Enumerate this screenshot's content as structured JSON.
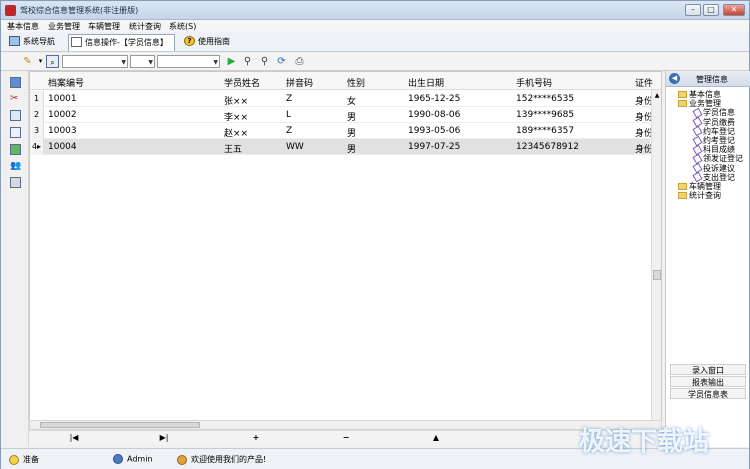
{
  "window": {
    "title": "驾校综合信息管理系统(非注册版)"
  },
  "menu": [
    "基本信息",
    "业务管理",
    "车辆管理",
    "统计查询",
    "系统(S)"
  ],
  "nav_tabs": [
    {
      "label": "系统导航",
      "icon": "monitor-icon"
    },
    {
      "label": "信息操作-【学员信息】",
      "icon": "document-icon"
    },
    {
      "label": "使用指南",
      "icon": "help-icon"
    }
  ],
  "grid": {
    "columns": [
      "档案编号",
      "学员姓名",
      "拼音码",
      "性别",
      "出生日期",
      "手机号码",
      "证件"
    ],
    "rows": [
      {
        "num": "1",
        "id": "10001",
        "name": "张××",
        "pinyin": "Z",
        "gender": "女",
        "birth": "1965-12-25",
        "phone": "152****6535",
        "cert": "身份"
      },
      {
        "num": "2",
        "id": "10002",
        "name": "李××",
        "pinyin": "L",
        "gender": "男",
        "birth": "1990-08-06",
        "phone": "139****9685",
        "cert": "身份"
      },
      {
        "num": "3",
        "id": "10003",
        "name": "赵××",
        "pinyin": "Z",
        "gender": "男",
        "birth": "1993-05-06",
        "phone": "189****6357",
        "cert": "身份"
      },
      {
        "num": "4",
        "id": "10004",
        "name": "王五",
        "pinyin": "WW",
        "gender": "男",
        "birth": "1997-07-25",
        "phone": "12345678912",
        "cert": "身份"
      }
    ]
  },
  "pager": {
    "first": "|◀",
    "last": "▶|",
    "add": "+",
    "remove": "−",
    "up": "▲"
  },
  "right_panel": {
    "title": "管理信息",
    "tree": [
      {
        "label": "基本信息",
        "type": "folder",
        "level": 0
      },
      {
        "label": "业务管理",
        "type": "folder",
        "level": 0
      },
      {
        "label": "学员信息",
        "type": "leaf",
        "level": 1
      },
      {
        "label": "学员缴费",
        "type": "leaf",
        "level": 1
      },
      {
        "label": "约车登记",
        "type": "leaf",
        "level": 1
      },
      {
        "label": "约考登记",
        "type": "leaf",
        "level": 1
      },
      {
        "label": "科目成绩",
        "type": "leaf",
        "level": 1
      },
      {
        "label": "领发证登记",
        "type": "leaf",
        "level": 1
      },
      {
        "label": "投诉建议",
        "type": "leaf",
        "level": 1
      },
      {
        "label": "支出登记",
        "type": "leaf",
        "level": 1
      },
      {
        "label": "车辆管理",
        "type": "folder",
        "level": 0
      },
      {
        "label": "统计查询",
        "type": "folder",
        "level": 0
      }
    ],
    "buttons": [
      "录入窗口",
      "报表输出",
      "学员信息表"
    ]
  },
  "status": {
    "state": "准备",
    "user": "Admin",
    "message": "欢迎使用我们的产品!"
  },
  "watermark": "极速下载站",
  "colors": {
    "accent": "#c0272d",
    "selected_row": "#e1e1e1",
    "folder": "#f2d36b"
  }
}
